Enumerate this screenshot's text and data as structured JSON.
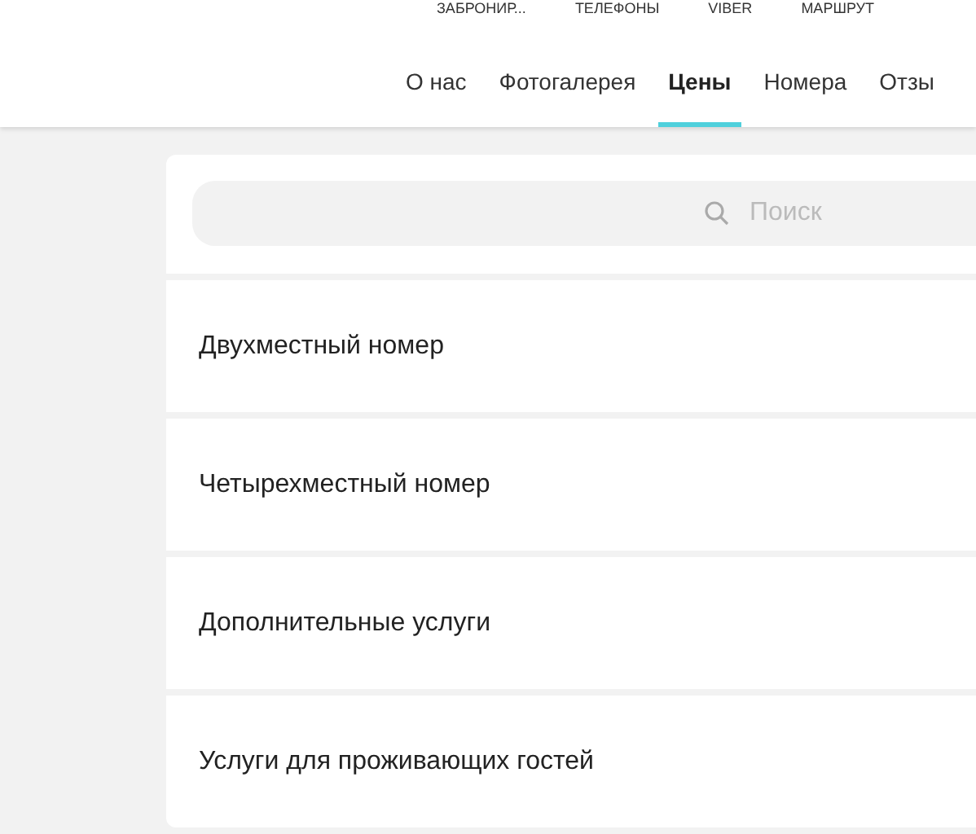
{
  "top_links": [
    "ЗАБРОНИР...",
    "ТЕЛЕФОНЫ",
    "VIBER",
    "МАРШРУТ"
  ],
  "nav": [
    {
      "label": "О нас",
      "selected": false
    },
    {
      "label": "Фотогалерея",
      "selected": false
    },
    {
      "label": "Цены",
      "selected": true
    },
    {
      "label": "Номера",
      "selected": false
    },
    {
      "label": "Отзы",
      "selected": false
    }
  ],
  "search": {
    "placeholder": "Поиск"
  },
  "sections": [
    "Двухместный номер",
    "Четырехместный номер",
    "Дополнительные услуги",
    "Услуги для проживающих гостей"
  ]
}
